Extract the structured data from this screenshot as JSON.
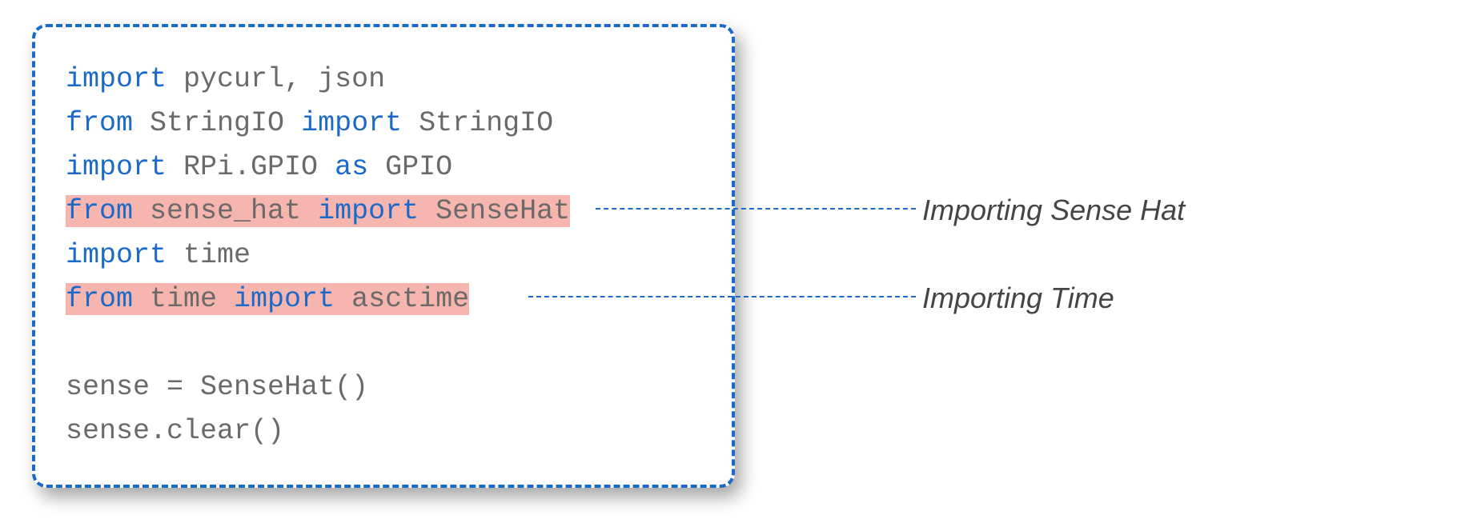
{
  "code": {
    "line1_kw": "import",
    "line1_rest": " pycurl, json",
    "line2_kw1": "from",
    "line2_mid": " StringIO ",
    "line2_kw2": "import",
    "line2_rest": " StringIO",
    "line3_kw1": "import",
    "line3_mid": " RPi.GPIO ",
    "line3_kw2": "as",
    "line3_rest": " GPIO",
    "line4_kw1": "from",
    "line4_mid": " sense_hat ",
    "line4_kw2": "import",
    "line4_rest": " SenseHat",
    "line5_kw": "import",
    "line5_rest": " time",
    "line6_kw1": "from",
    "line6_mid": " time ",
    "line6_kw2": "import",
    "line6_rest": " asctime",
    "blank": " ",
    "line8": "sense = SenseHat()",
    "line9": "sense.clear()"
  },
  "annotations": {
    "sensehat": "Importing Sense Hat",
    "time": "Importing Time"
  }
}
